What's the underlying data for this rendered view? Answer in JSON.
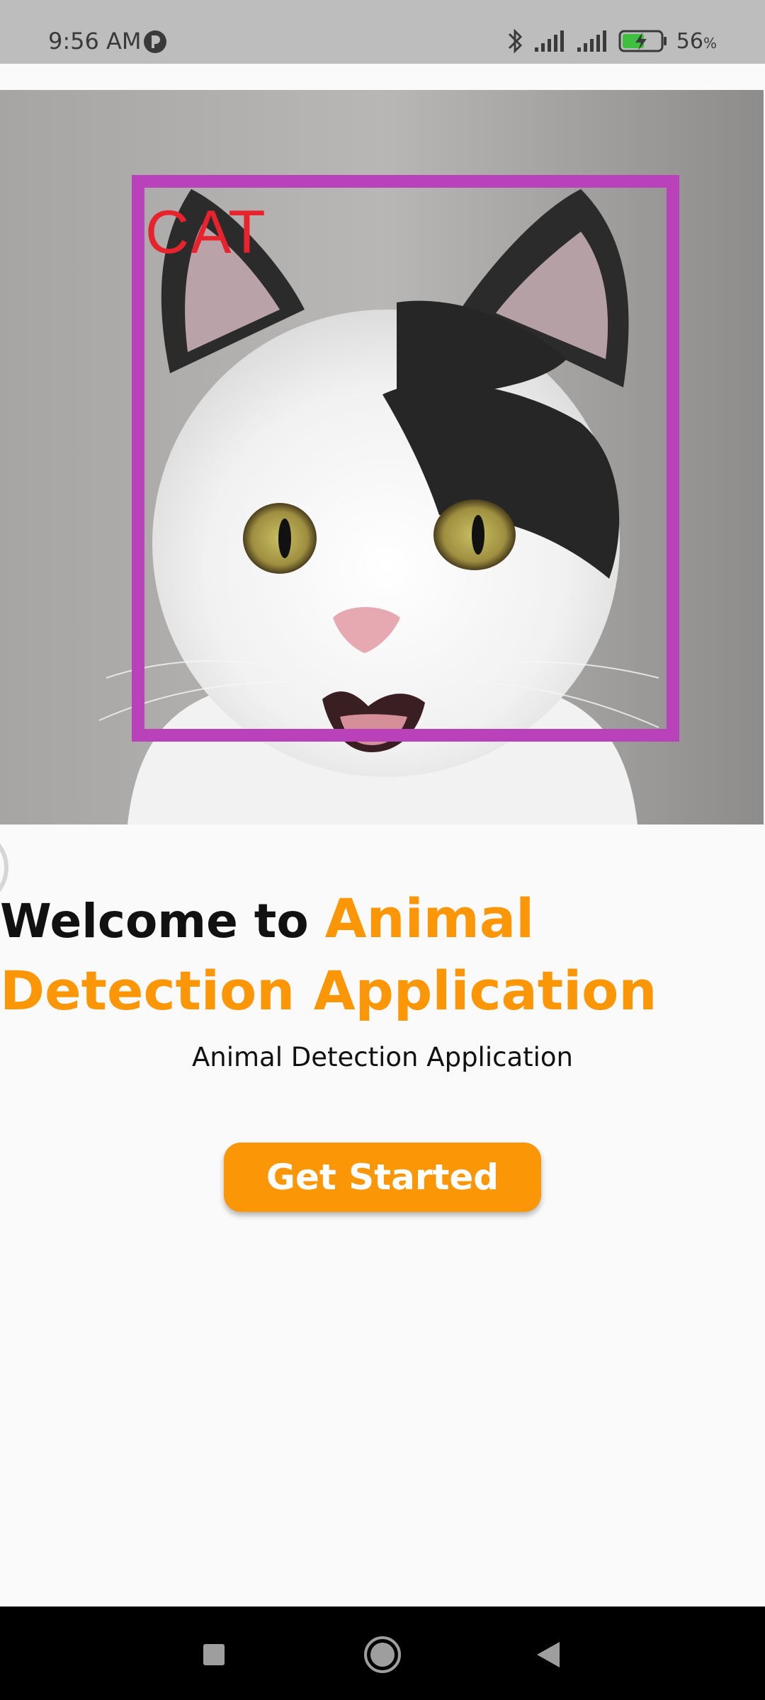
{
  "status_bar": {
    "time": "9:56 AM",
    "battery_percent": "56",
    "battery_unit": "%",
    "icons": [
      "app-notification-icon",
      "bluetooth-icon",
      "signal-icon",
      "signal-icon",
      "battery-charging-icon"
    ]
  },
  "hero": {
    "detection_label": "CAT",
    "box_color": "#b941b9",
    "label_color": "#e8232e"
  },
  "welcome": {
    "prefix": "Welcome to ",
    "accent": "Animal Detection Application",
    "accent_color": "#fb9607"
  },
  "subtitle": "Animal Detection Application",
  "cta": {
    "label": "Get Started",
    "color": "#fb9607"
  },
  "nav": {
    "items": [
      "recents-icon",
      "home-icon",
      "back-icon"
    ]
  }
}
